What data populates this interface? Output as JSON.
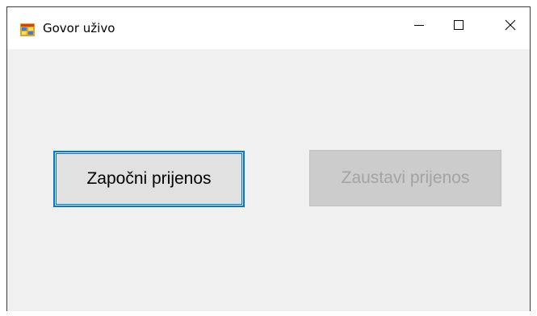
{
  "window": {
    "title": "Govor uživo",
    "controls": {
      "minimize_icon": "minimize-icon",
      "maximize_icon": "maximize-icon",
      "close_icon": "close-icon"
    }
  },
  "buttons": {
    "start_label": "Započni prijenos",
    "stop_label": "Zaustavi prijenos"
  },
  "colors": {
    "focus_border": "#0078d7",
    "button_face": "#e1e1e1",
    "disabled_face": "#cccccc",
    "disabled_text": "#a3a3a3",
    "window_bg": "#f0f0f0"
  }
}
